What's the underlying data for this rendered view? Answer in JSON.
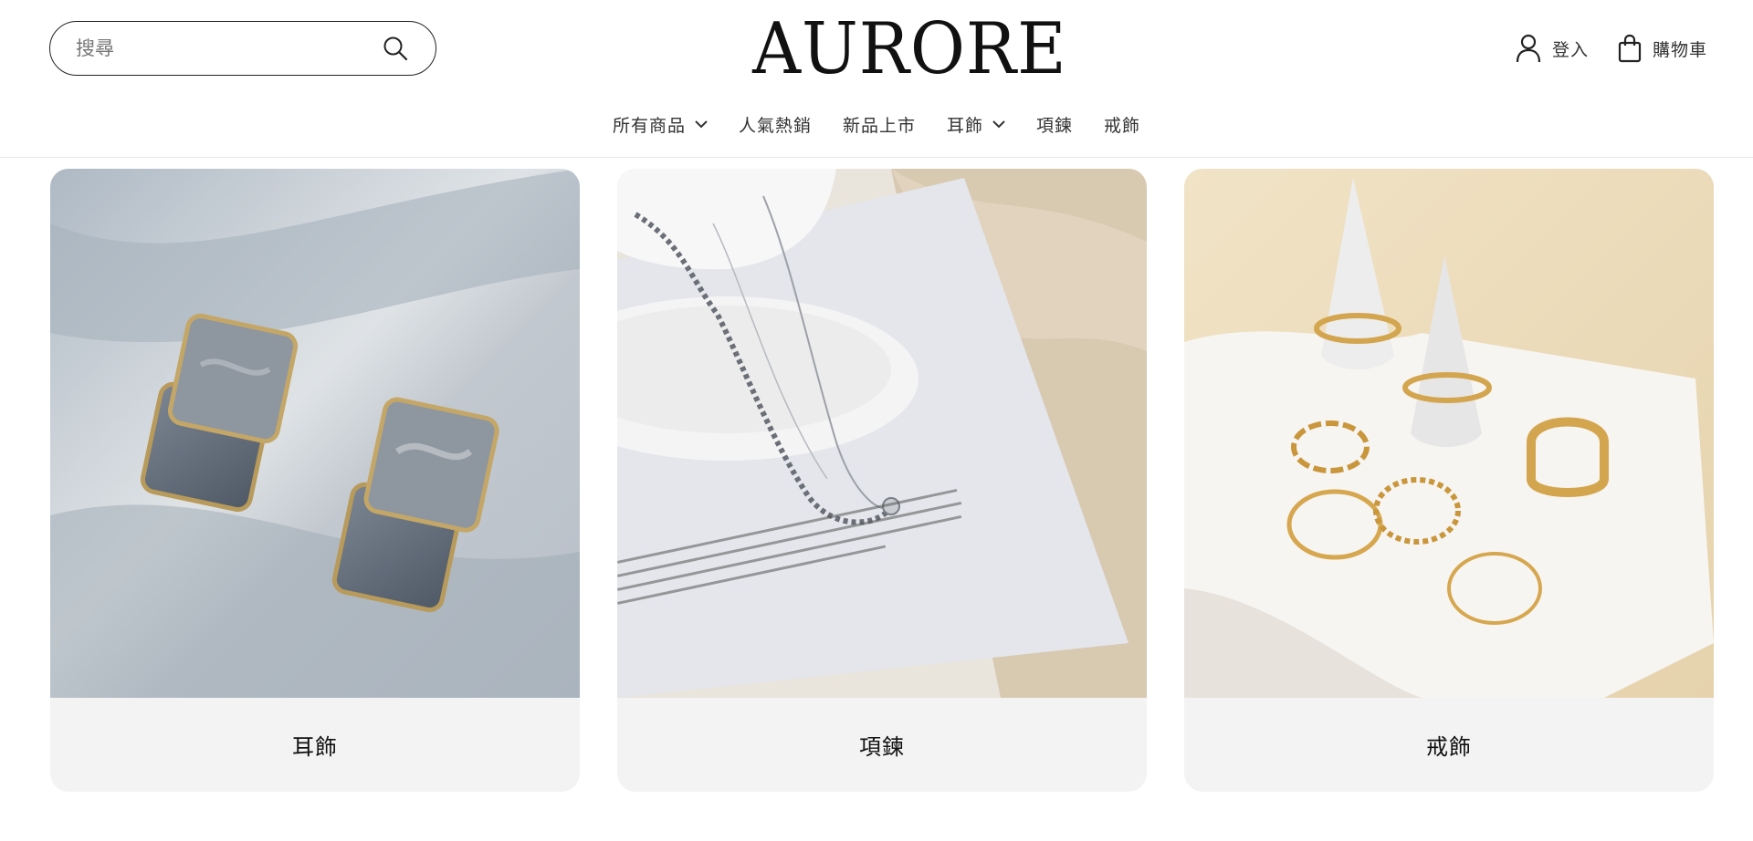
{
  "header": {
    "search": {
      "placeholder": "搜尋",
      "value": ""
    },
    "logo": "AURORE",
    "account_label": "登入",
    "cart_label": "購物車"
  },
  "nav": {
    "items": [
      {
        "label": "所有商品",
        "has_dropdown": true
      },
      {
        "label": "人氣熱銷",
        "has_dropdown": false
      },
      {
        "label": "新品上市",
        "has_dropdown": false
      },
      {
        "label": "耳飾",
        "has_dropdown": true
      },
      {
        "label": "項鍊",
        "has_dropdown": false
      },
      {
        "label": "戒飾",
        "has_dropdown": false
      }
    ]
  },
  "collections": [
    {
      "title": "耳飾",
      "image": "earrings-photo"
    },
    {
      "title": "項鍊",
      "image": "necklace-photo"
    },
    {
      "title": "戒飾",
      "image": "rings-photo"
    }
  ],
  "icons": [
    "search-icon",
    "user-icon",
    "shopping-bag-icon",
    "chevron-down-icon"
  ],
  "colors": {
    "text": "#222222",
    "card_background": "#f3f3f3",
    "border": "#e8e8e8"
  }
}
